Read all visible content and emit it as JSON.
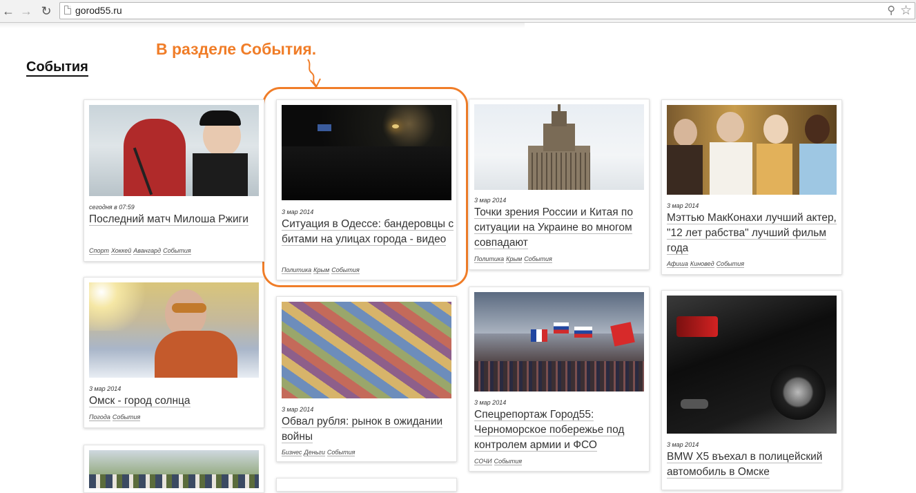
{
  "browser": {
    "url": "gorod55.ru",
    "icons": {
      "back": "back-arrow-icon",
      "forward": "forward-arrow-icon",
      "reload": "reload-icon",
      "page": "page-icon",
      "zoom": "magnifier-icon",
      "bookmark": "star-icon"
    }
  },
  "page": {
    "section_title": "События"
  },
  "annotation": {
    "text": "В разделе События."
  },
  "cards": [
    {
      "date": "сегодня в 07:59",
      "title": "Последний матч Милоша Ржиги",
      "tags": [
        "Спорт",
        "Хоккей",
        "Авангард",
        "События"
      ]
    },
    {
      "date": "3 мар 2014",
      "title": "Ситуация в Одессе: бандеровцы с битами на улицах города - видео",
      "tags": [
        "Политика",
        "Крым",
        "События"
      ]
    },
    {
      "date": "3 мар 2014",
      "title": "Точки зрения России и Китая по ситуации на Украине во многом совпадают",
      "tags": [
        "Политика",
        "Крым",
        "События"
      ]
    },
    {
      "date": "3 мар 2014",
      "title": "Мэттью МакКонахи лучший актер, \"12 лет рабства\" лучший фильм года",
      "tags": [
        "Афиша",
        "Киновед",
        "События"
      ]
    },
    {
      "date": "3 мар 2014",
      "title": "Омск - город солнца",
      "tags": [
        "Погода",
        "События"
      ]
    },
    {
      "date": "3 мар 2014",
      "title": "Обвал рубля: рынок в ожидании войны",
      "tags": [
        "Бизнес",
        "Деньги",
        "События"
      ]
    },
    {
      "date": "3 мар 2014",
      "title": "Спецрепортаж Город55: Черноморское побережье под контролем армии и ФСО",
      "tags": [
        "СОЧИ",
        "События"
      ]
    },
    {
      "date": "3 мар 2014",
      "title": "BMW X5 въехал в полицейский автомобиль в Омске",
      "tags": []
    }
  ]
}
